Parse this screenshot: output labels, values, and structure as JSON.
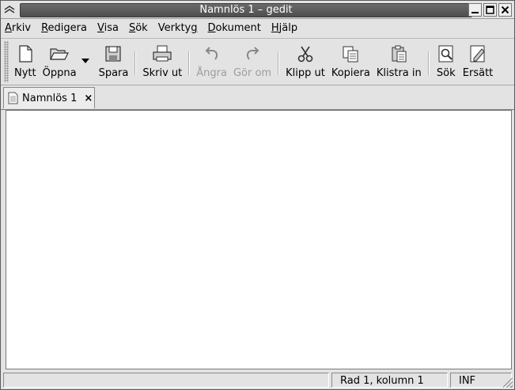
{
  "window": {
    "title": "Namnlös 1 – gedit",
    "controls": [
      "minimize-icon",
      "maximize-icon",
      "close-icon"
    ]
  },
  "menubar": {
    "items": [
      {
        "label": "Arkiv",
        "mnemonic_index": 0
      },
      {
        "label": "Redigera",
        "mnemonic_index": 0
      },
      {
        "label": "Visa",
        "mnemonic_index": 0
      },
      {
        "label": "Sök",
        "mnemonic_index": 0
      },
      {
        "label": "Verktyg",
        "mnemonic_index": 6
      },
      {
        "label": "Dokument",
        "mnemonic_index": 0
      },
      {
        "label": "Hjälp",
        "mnemonic_index": 0
      }
    ]
  },
  "toolbar": {
    "new_label": "Nytt",
    "open_label": "Öppna",
    "save_label": "Spara",
    "print_label": "Skriv ut",
    "undo_label": "Ångra",
    "redo_label": "Gör om",
    "cut_label": "Klipp ut",
    "copy_label": "Kopiera",
    "paste_label": "Klistra in",
    "find_label": "Sök",
    "replace_label": "Ersätt",
    "disabled": [
      "undo",
      "redo"
    ]
  },
  "tabs": [
    {
      "label": "Namnlös 1",
      "icon": "document-icon",
      "close_symbol": "×"
    }
  ],
  "editor": {
    "content": ""
  },
  "statusbar": {
    "message": "",
    "position": "Rad 1, kolumn 1",
    "mode": "INF"
  }
}
